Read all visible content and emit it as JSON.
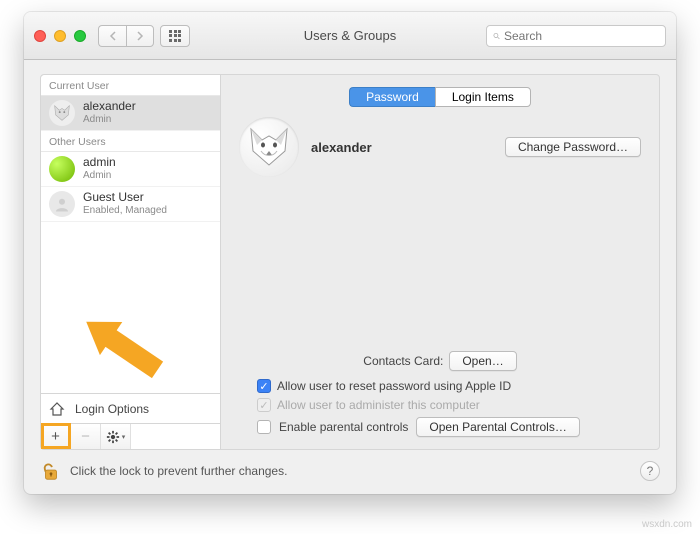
{
  "window": {
    "title": "Users & Groups",
    "search_placeholder": "Search"
  },
  "sidebar": {
    "sections": {
      "current_label": "Current User",
      "other_label": "Other Users"
    },
    "current_user": {
      "name": "alexander",
      "role": "Admin"
    },
    "other_users": [
      {
        "name": "admin",
        "role": "Admin"
      },
      {
        "name": "Guest User",
        "role": "Enabled, Managed"
      }
    ],
    "login_options_label": "Login Options"
  },
  "main": {
    "tabs": {
      "password": "Password",
      "login_items": "Login Items"
    },
    "user_name": "alexander",
    "change_password_btn": "Change Password…",
    "contacts_label": "Contacts Card:",
    "open_btn": "Open…",
    "check_reset": "Allow user to reset password using Apple ID",
    "check_admin": "Allow user to administer this computer",
    "check_parental": "Enable parental controls",
    "open_parental_btn": "Open Parental Controls…"
  },
  "footer": {
    "lock_text": "Click the lock to prevent further changes."
  },
  "watermark": "wsxdn.com"
}
